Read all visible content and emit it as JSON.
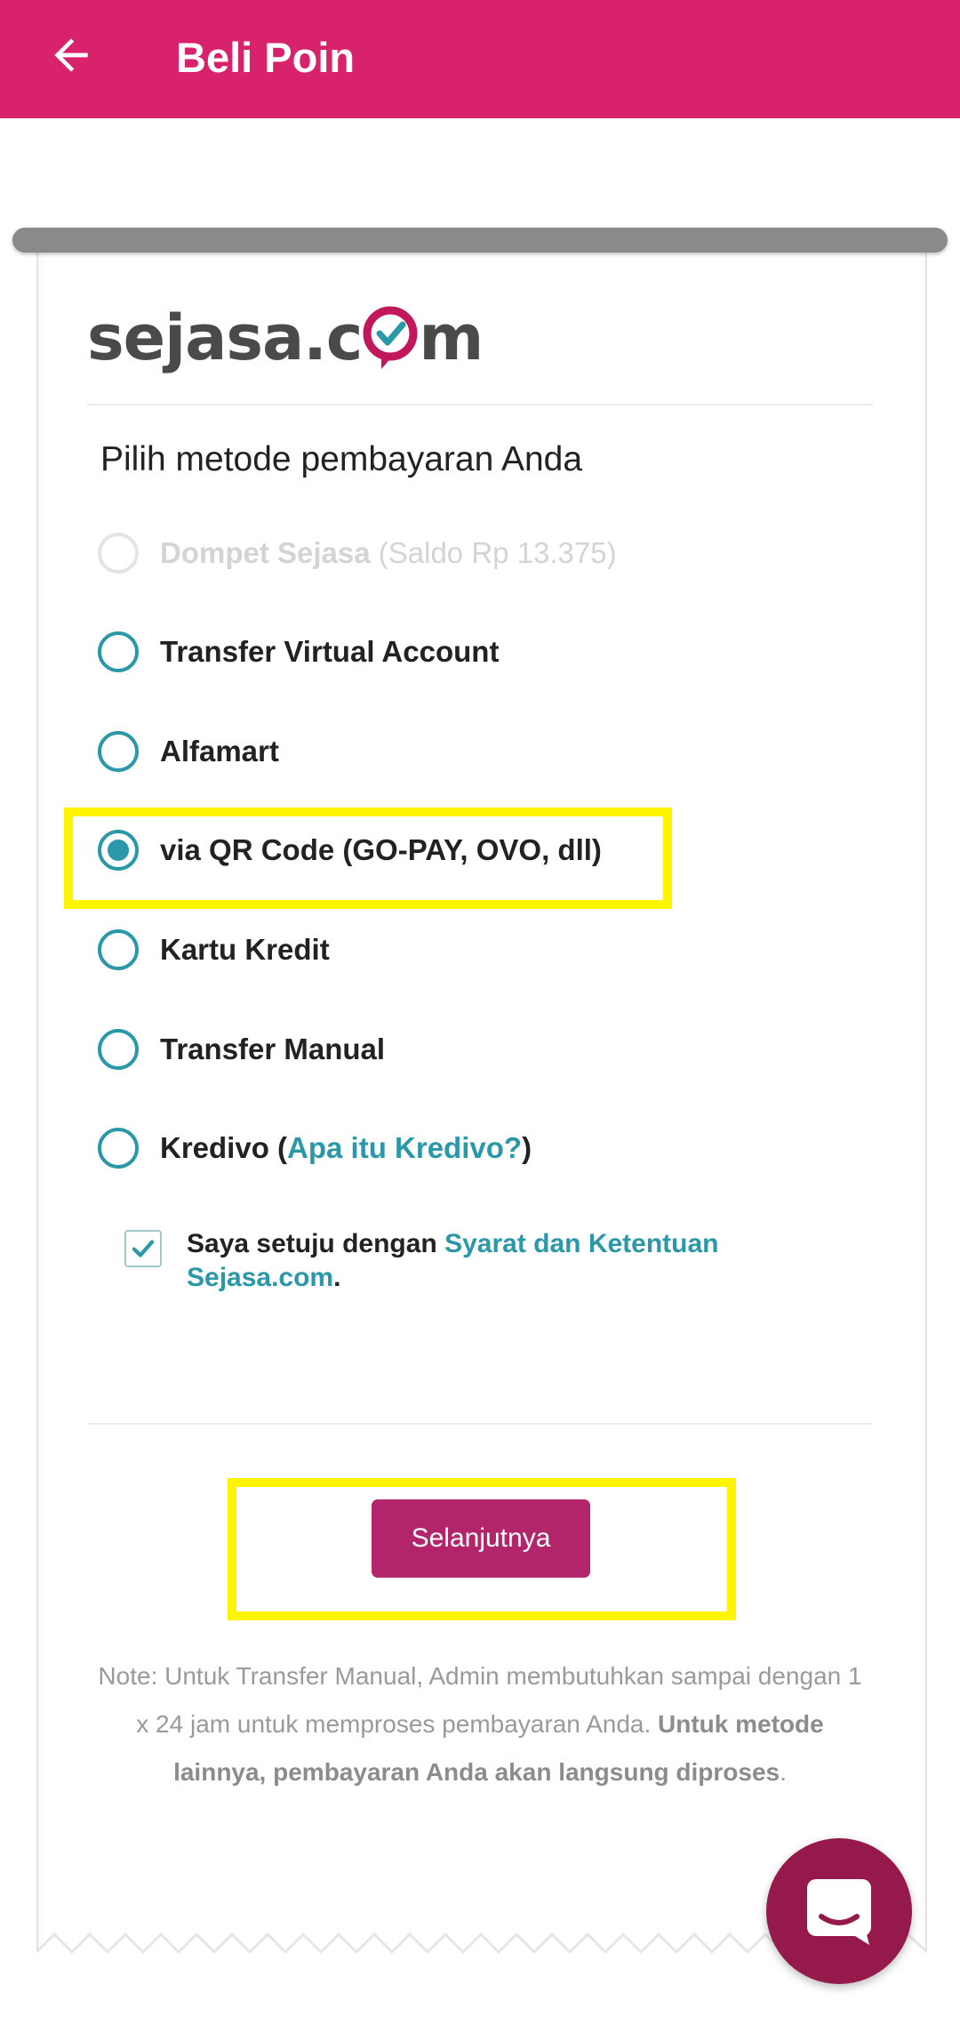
{
  "header": {
    "title": "Beli Poin",
    "back_icon": "arrow-left-icon"
  },
  "logo": {
    "text_prefix": "sejasa.c",
    "text_suffix": "m"
  },
  "section_title": "Pilih metode pembayaran Anda",
  "payment_options": [
    {
      "label": "Dompet Sejasa",
      "sub_label": "(Saldo Rp 13.375)",
      "disabled": true,
      "selected": false
    },
    {
      "label": "Transfer Virtual Account",
      "disabled": false,
      "selected": false
    },
    {
      "label": "Alfamart",
      "disabled": false,
      "selected": false
    },
    {
      "label": "via QR Code (GO-PAY, OVO, dll)",
      "disabled": false,
      "selected": true
    },
    {
      "label": "Kartu Kredit",
      "disabled": false,
      "selected": false
    },
    {
      "label": "Transfer Manual",
      "disabled": false,
      "selected": false
    },
    {
      "label": "Kredivo (",
      "link": "Apa itu Kredivo?",
      "suffix": ")",
      "disabled": false,
      "selected": false
    }
  ],
  "agreement": {
    "checked": true,
    "text": "Saya setuju dengan ",
    "link": "Syarat dan Ketentuan Sejasa.com",
    "suffix": "."
  },
  "next_button": "Selanjutnya",
  "note": {
    "text": "Note: Untuk Transfer Manual, Admin membutuhkan sampai dengan 1 x 24 jam untuk memproses pembayaran Anda. ",
    "bold": "Untuk metode lainnya, pembayaran Anda akan langsung diproses",
    "suffix": "."
  },
  "chat_button_icon": "chat-icon",
  "colors": {
    "appbar": "#d8226c",
    "accent": "#2a98a8",
    "button": "#b3256a",
    "highlight": "#fff500"
  }
}
